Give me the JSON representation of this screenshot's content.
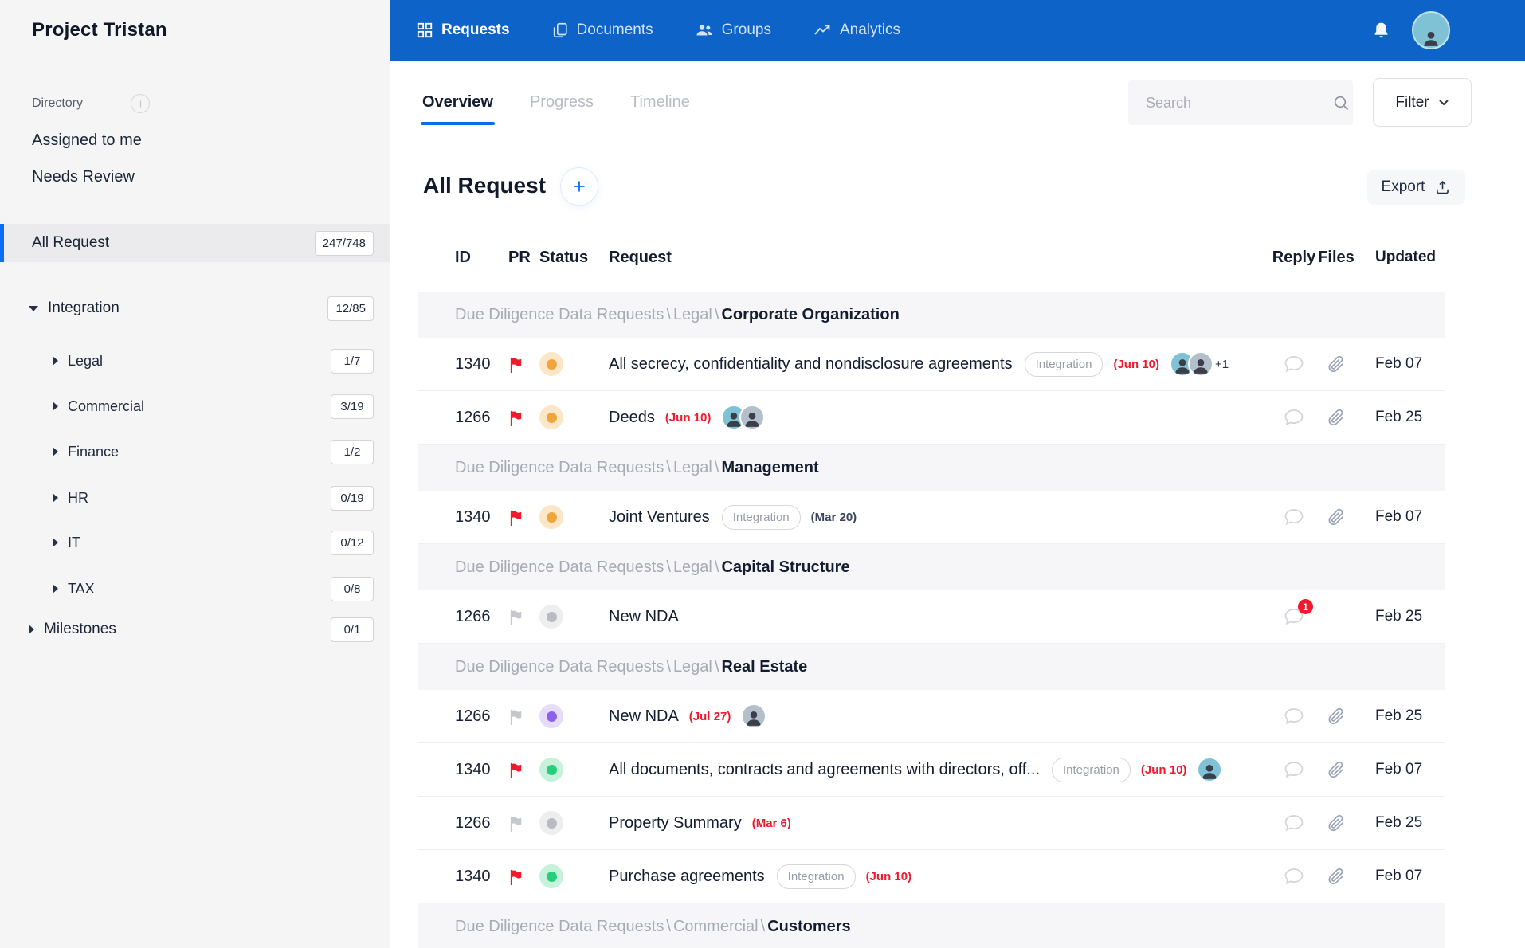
{
  "colors": {
    "nav_blue": "#0d63c8",
    "accent_blue": "#0b6cf3",
    "red": "#f01a2c",
    "orange_status": "#efa43d",
    "green_status": "#25ce7b",
    "purple_status": "#8a63e8",
    "gray_status": "#b8bbc1",
    "sidebar_bg": "#f5f5f6"
  },
  "sidebar": {
    "project_title": "Project Tristan",
    "directory_label": "Directory",
    "shortcuts": [
      {
        "label": "Assigned to me"
      },
      {
        "label": "Needs Review"
      }
    ],
    "items": [
      {
        "label": "All Request",
        "count": "247/748",
        "level": 0,
        "arrow": "none",
        "selected": true
      },
      {
        "label": "Integration",
        "count": "12/85",
        "level": 0,
        "arrow": "down",
        "selected": false
      },
      {
        "label": "Legal",
        "count": "1/7",
        "level": 1,
        "arrow": "right",
        "selected": false
      },
      {
        "label": "Commercial",
        "count": "3/19",
        "level": 1,
        "arrow": "right",
        "selected": false
      },
      {
        "label": "Finance",
        "count": "1/2",
        "level": 1,
        "arrow": "right",
        "selected": false
      },
      {
        "label": "HR",
        "count": "0/19",
        "level": 1,
        "arrow": "right",
        "selected": false
      },
      {
        "label": "IT",
        "count": "0/12",
        "level": 1,
        "arrow": "right",
        "selected": false
      },
      {
        "label": "TAX",
        "count": "0/8",
        "level": 1,
        "arrow": "right",
        "selected": false
      },
      {
        "label": "Milestones",
        "count": "0/1",
        "level": 0,
        "arrow": "right",
        "selected": false
      }
    ]
  },
  "topnav": {
    "items": [
      {
        "label": "Requests",
        "icon": "grid-icon",
        "active": true
      },
      {
        "label": "Documents",
        "icon": "documents-icon",
        "active": false
      },
      {
        "label": "Groups",
        "icon": "groups-icon",
        "active": false
      },
      {
        "label": "Analytics",
        "icon": "analytics-icon",
        "active": false
      }
    ]
  },
  "tabs": [
    {
      "label": "Overview",
      "active": true
    },
    {
      "label": "Progress",
      "active": false
    },
    {
      "label": "Timeline",
      "active": false
    }
  ],
  "toolbar": {
    "search_placeholder": "Search",
    "filter_label": "Filter",
    "export_label": "Export"
  },
  "content": {
    "title": "All Request"
  },
  "table": {
    "headers": {
      "id": "ID",
      "pr": "PR",
      "status": "Status",
      "request": "Request",
      "reply": "Reply",
      "files": "Files",
      "updated": "Updated"
    },
    "rows": [
      {
        "type": "group",
        "path": [
          "Due Diligence Data Requests",
          "Legal"
        ],
        "leaf": "Corporate Organization"
      },
      {
        "type": "item",
        "id": "1340",
        "flag": "red",
        "status": "orange",
        "title": "All secrecy, confidentiality and nondisclosure agreements",
        "tag": "Integration",
        "date": "(Jun 10)",
        "date_style": "red",
        "avatars": [
          "teal",
          "slate"
        ],
        "avatars_extra": "+1",
        "reply_badge": null,
        "files": true,
        "updated": "Feb 07"
      },
      {
        "type": "item",
        "id": "1266",
        "flag": "red",
        "status": "orange",
        "title": "Deeds",
        "tag": null,
        "date": "(Jun 10)",
        "date_style": "red",
        "avatars": [
          "teal",
          "slate"
        ],
        "avatars_extra": null,
        "reply_badge": null,
        "files": true,
        "updated": "Feb 25"
      },
      {
        "type": "group",
        "path": [
          "Due Diligence Data Requests",
          "Legal"
        ],
        "leaf": "Management"
      },
      {
        "type": "item",
        "id": "1340",
        "flag": "red",
        "status": "orange",
        "title": "Joint Ventures",
        "tag": "Integration",
        "date": "(Mar 20)",
        "date_style": "dark",
        "avatars": [],
        "avatars_extra": null,
        "reply_badge": null,
        "files": true,
        "updated": "Feb 07"
      },
      {
        "type": "group",
        "path": [
          "Due Diligence Data Requests",
          "Legal"
        ],
        "leaf": "Capital Structure"
      },
      {
        "type": "item",
        "id": "1266",
        "flag": "gray",
        "status": "gray",
        "title": "New NDA",
        "tag": null,
        "date": null,
        "date_style": null,
        "avatars": [],
        "avatars_extra": null,
        "reply_badge": "1",
        "files": false,
        "updated": "Feb 25"
      },
      {
        "type": "group",
        "path": [
          "Due Diligence Data Requests",
          "Legal"
        ],
        "leaf": "Real Estate"
      },
      {
        "type": "item",
        "id": "1266",
        "flag": "gray",
        "status": "purple",
        "title": "New NDA",
        "tag": null,
        "date": "(Jul 27)",
        "date_style": "red",
        "avatars": [
          "slate"
        ],
        "avatars_extra": null,
        "reply_badge": null,
        "files": true,
        "updated": "Feb 25"
      },
      {
        "type": "item",
        "id": "1340",
        "flag": "red",
        "status": "green",
        "title": "All documents, contracts and agreements with directors, off...",
        "tag": "Integration",
        "date": "(Jun 10)",
        "date_style": "red",
        "avatars": [
          "teal"
        ],
        "avatars_extra": null,
        "reply_badge": null,
        "files": true,
        "updated": "Feb 07"
      },
      {
        "type": "item",
        "id": "1266",
        "flag": "gray",
        "status": "gray",
        "title": "Property Summary",
        "tag": null,
        "date": "(Mar 6)",
        "date_style": "red",
        "avatars": [],
        "avatars_extra": null,
        "reply_badge": null,
        "files": true,
        "updated": "Feb 25"
      },
      {
        "type": "item",
        "id": "1340",
        "flag": "red",
        "status": "green",
        "title": "Purchase agreements",
        "tag": "Integration",
        "date": "(Jun 10)",
        "date_style": "red",
        "avatars": [],
        "avatars_extra": null,
        "reply_badge": null,
        "files": true,
        "updated": "Feb 07"
      },
      {
        "type": "group",
        "path": [
          "Due Diligence Data Requests",
          "Commercial"
        ],
        "leaf": "Customers"
      }
    ]
  }
}
